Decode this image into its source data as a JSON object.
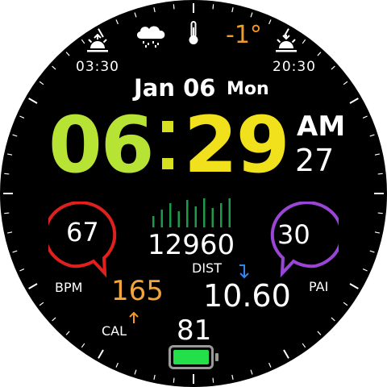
{
  "watchface": {
    "sunrise": {
      "time": "03:30",
      "icon": "sunrise-icon"
    },
    "sunset": {
      "time": "20:30",
      "icon": "sunset-icon"
    },
    "weather": {
      "icon": "cloud-rain-icon",
      "thermometer_icon": "thermometer-icon",
      "temperature": "-1°"
    },
    "date": {
      "month_day": "Jan 06",
      "weekday": "Mon"
    },
    "time": {
      "hours": "06",
      "separator": ":",
      "minutes": "29",
      "ampm": "AM",
      "seconds": "27"
    },
    "heart_rate": {
      "value": "67",
      "label": "BPM"
    },
    "pai": {
      "value": "30",
      "label": "PAI"
    },
    "steps": {
      "value": "12960"
    },
    "distance": {
      "label": "DIST",
      "value": "10.60"
    },
    "calories": {
      "value": "165",
      "label": "CAL"
    },
    "battery": {
      "value": "81",
      "level": 0.81
    },
    "colors": {
      "hours": "#b7e334",
      "colon": "#d6e021",
      "minutes": "#f1e11c",
      "bpm_ring": "#e0201f",
      "pai_ring": "#9a45d6",
      "steps_bars": "#1f9a4a",
      "calories": "#f1a43b",
      "distance_arrow": "#2f86f0",
      "battery_fill": "#23e04a",
      "accent_orange": "#f19a2a"
    }
  }
}
